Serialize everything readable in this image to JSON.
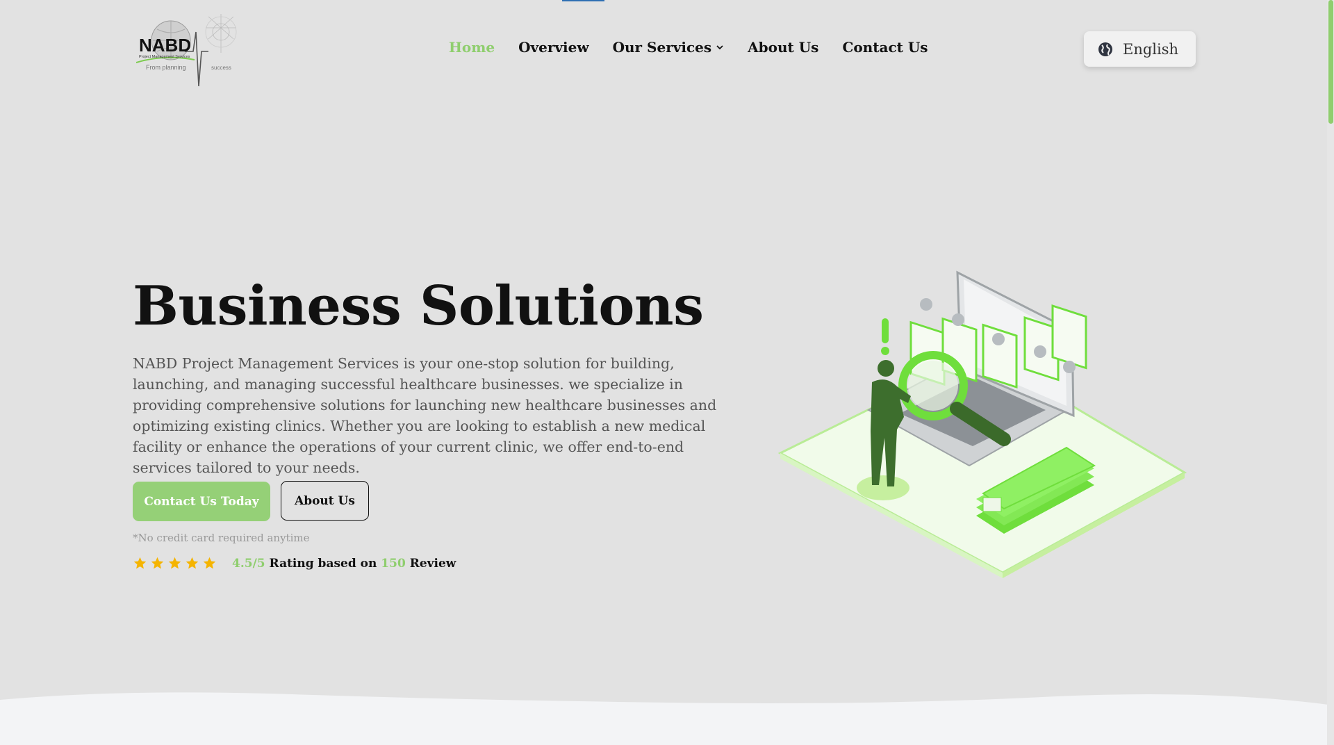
{
  "header": {
    "logo": {
      "brand": "NABD",
      "subtitle": "Project Management Services",
      "tagline_left": "From planning",
      "tagline_right": "success"
    },
    "nav": [
      {
        "label": "Home",
        "active": true
      },
      {
        "label": "Overview",
        "active": false
      },
      {
        "label": "Our Services",
        "active": false,
        "has_dropdown": true
      },
      {
        "label": "About Us",
        "active": false
      },
      {
        "label": "Contact Us",
        "active": false
      }
    ],
    "language": {
      "label": "English",
      "icon": "globe-icon"
    }
  },
  "hero": {
    "title": "Business Solutions",
    "description": "NABD Project Management Services is your one-stop solution for building, launching, and managing successful healthcare businesses. we specialize in providing comprehensive solutions for launching new healthcare businesses and optimizing existing clinics. Whether you are looking to establish a new medical facility or enhance the operations of your current clinic, we offer end-to-end services tailored to your needs.",
    "primary_button": "Contact Us Today",
    "secondary_button": "About Us",
    "note": "*No credit card required anytime",
    "rating": {
      "stars": 5,
      "score": "4.5/5",
      "text_mid": "Rating based on",
      "count": "150",
      "text_end": "Review"
    }
  },
  "colors": {
    "accent": "#8fce6e",
    "star": "#f5b400",
    "background": "#e2e2e2",
    "wave": "#f3f4f6"
  }
}
